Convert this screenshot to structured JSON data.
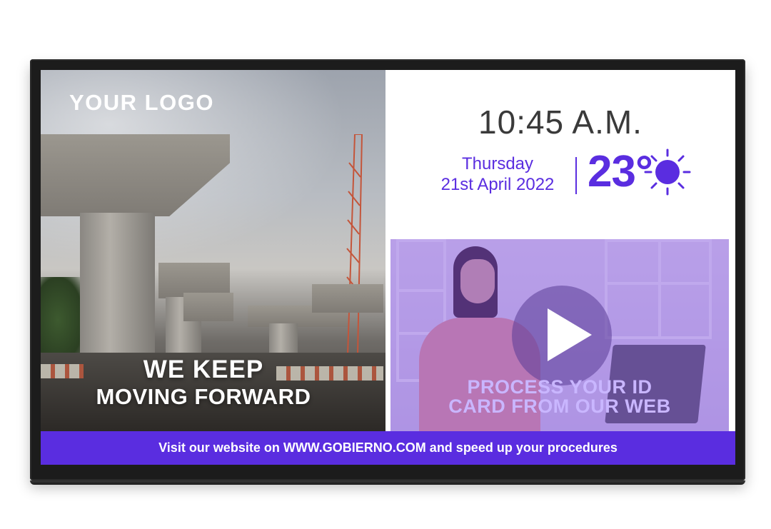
{
  "display": {
    "logo_text": "YOUR LOGO",
    "headline_line1": "WE KEEP",
    "headline_line2": "MOVING FORWARD"
  },
  "clock": {
    "time": "10:45 A.M.",
    "weekday": "Thursday",
    "date": "21st April 2022"
  },
  "weather": {
    "temperature": "23°",
    "icon": "sun-icon"
  },
  "video": {
    "caption_line1": "PROCESS YOUR ID",
    "caption_line2": "CARD FROM OUR WEB",
    "icon": "play-icon"
  },
  "banner": {
    "text": "Visit our website on WWW.GOBIERNO.COM and speed up your procedures"
  },
  "colors": {
    "accent": "#5a2de0",
    "bezel": "#1c1c1c"
  }
}
